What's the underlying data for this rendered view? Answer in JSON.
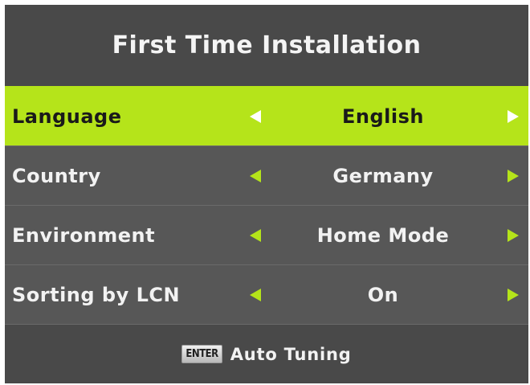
{
  "title": "First Time Installation",
  "settings": [
    {
      "label": "Language",
      "value": "English",
      "selected": true
    },
    {
      "label": "Country",
      "value": "Germany",
      "selected": false
    },
    {
      "label": "Environment",
      "value": "Home Mode",
      "selected": false
    },
    {
      "label": "Sorting by LCN",
      "value": "On",
      "selected": false
    }
  ],
  "footer": {
    "key_label": "ENTER",
    "action_label": "Auto Tuning"
  },
  "colors": {
    "accent": "#b5e41a",
    "background": "#525252",
    "header": "#494949"
  },
  "icons": {
    "left": "triangle-left-icon",
    "right": "triangle-right-icon"
  }
}
